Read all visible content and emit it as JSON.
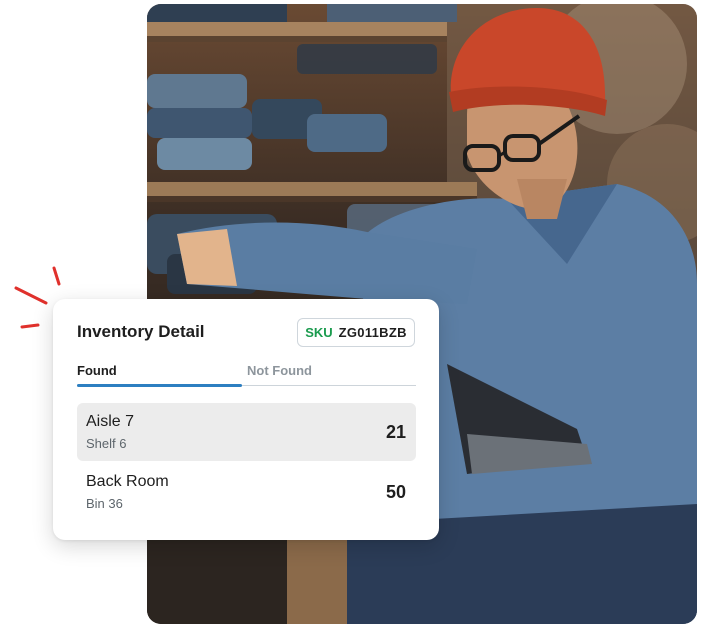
{
  "card": {
    "title": "Inventory Detail",
    "sku_label": "SKU",
    "sku_value": "ZG011BZB",
    "tabs": [
      {
        "label": "Found",
        "active": true
      },
      {
        "label": "Not Found",
        "active": false
      }
    ],
    "locations": [
      {
        "name": "Aisle 7",
        "detail": "Shelf 6",
        "quantity": "21"
      },
      {
        "name": "Back Room",
        "detail": "Bin 36",
        "quantity": "50"
      }
    ]
  },
  "colors": {
    "accent_red": "#e0312c",
    "sku_green": "#1a9b4e",
    "tab_underline": "#2d7fc1"
  },
  "icons": [
    "accent-marks-icon"
  ]
}
